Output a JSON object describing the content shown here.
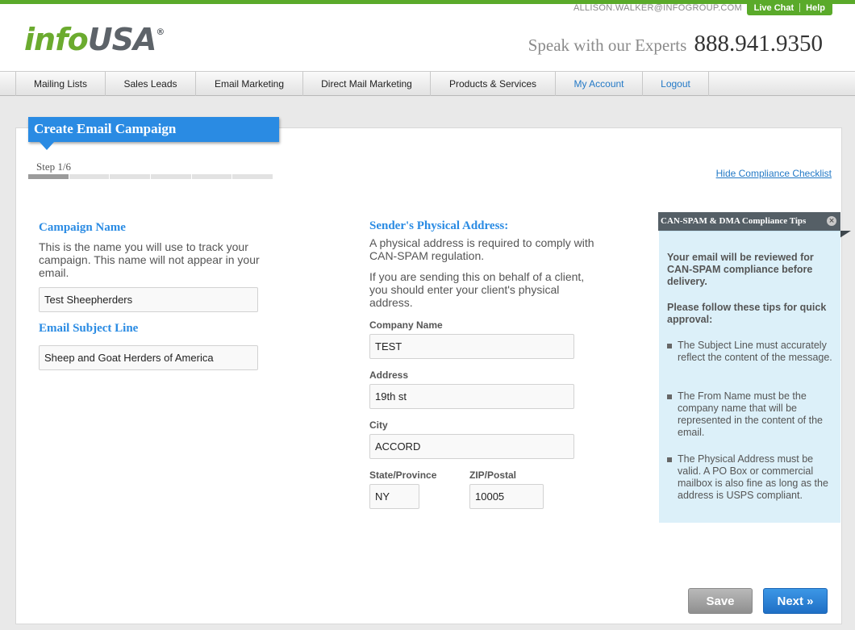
{
  "header": {
    "logo": {
      "part1": "info",
      "part2": "USA",
      "reg": "®"
    },
    "user_email": "ALLISON.WALKER@INFOGROUP.COM",
    "live_chat": "Live Chat",
    "help": "Help",
    "phone_prefix": "Speak with our Experts",
    "phone_number": "888.941.9350"
  },
  "nav": {
    "items": [
      {
        "label": "Mailing Lists"
      },
      {
        "label": "Sales Leads"
      },
      {
        "label": "Email Marketing"
      },
      {
        "label": "Direct Mail Marketing"
      },
      {
        "label": "Products & Services"
      },
      {
        "label": "My Account"
      },
      {
        "label": "Logout"
      }
    ]
  },
  "page": {
    "title": "Create Email Campaign",
    "step_label": "Step 1/6",
    "step_current": 1,
    "step_total": 6,
    "hide_checklist": "Hide Compliance Checklist"
  },
  "campaign": {
    "name_title": "Campaign Name",
    "name_desc": "This is the name you will use to track your campaign. This name will not appear in your email.",
    "name_value": "Test Sheepherders",
    "subject_title": "Email Subject Line",
    "subject_value": "Sheep and Goat Herders of America"
  },
  "sender": {
    "title": "Sender's Physical Address:",
    "desc1": "A physical address is required to comply with CAN-SPAM regulation.",
    "desc2": "If you are sending this on behalf of a client, you should enter your client's physical address.",
    "company_label": "Company Name",
    "company_value": "TEST",
    "address_label": "Address",
    "address_value": "19th st",
    "city_label": "City",
    "city_value": "ACCORD",
    "state_label": "State/Province",
    "state_value": "NY",
    "zip_label": "ZIP/Postal",
    "zip_value": "10005"
  },
  "tips": {
    "title": "CAN-SPAM & DMA Compliance Tips",
    "close": "×",
    "intro": "Your email will be reviewed for CAN-SPAM compliance before delivery.",
    "follow": "Please follow these tips for quick approval:",
    "items": [
      "The Subject Line must accurately reflect the content of the message.",
      "The From Name must be the company name that will be represented in the content of the email.",
      "The Physical Address must be valid. A PO Box or commercial mailbox is also fine as long as the address is USPS compliant."
    ]
  },
  "actions": {
    "save": "Save",
    "next": "Next »"
  }
}
